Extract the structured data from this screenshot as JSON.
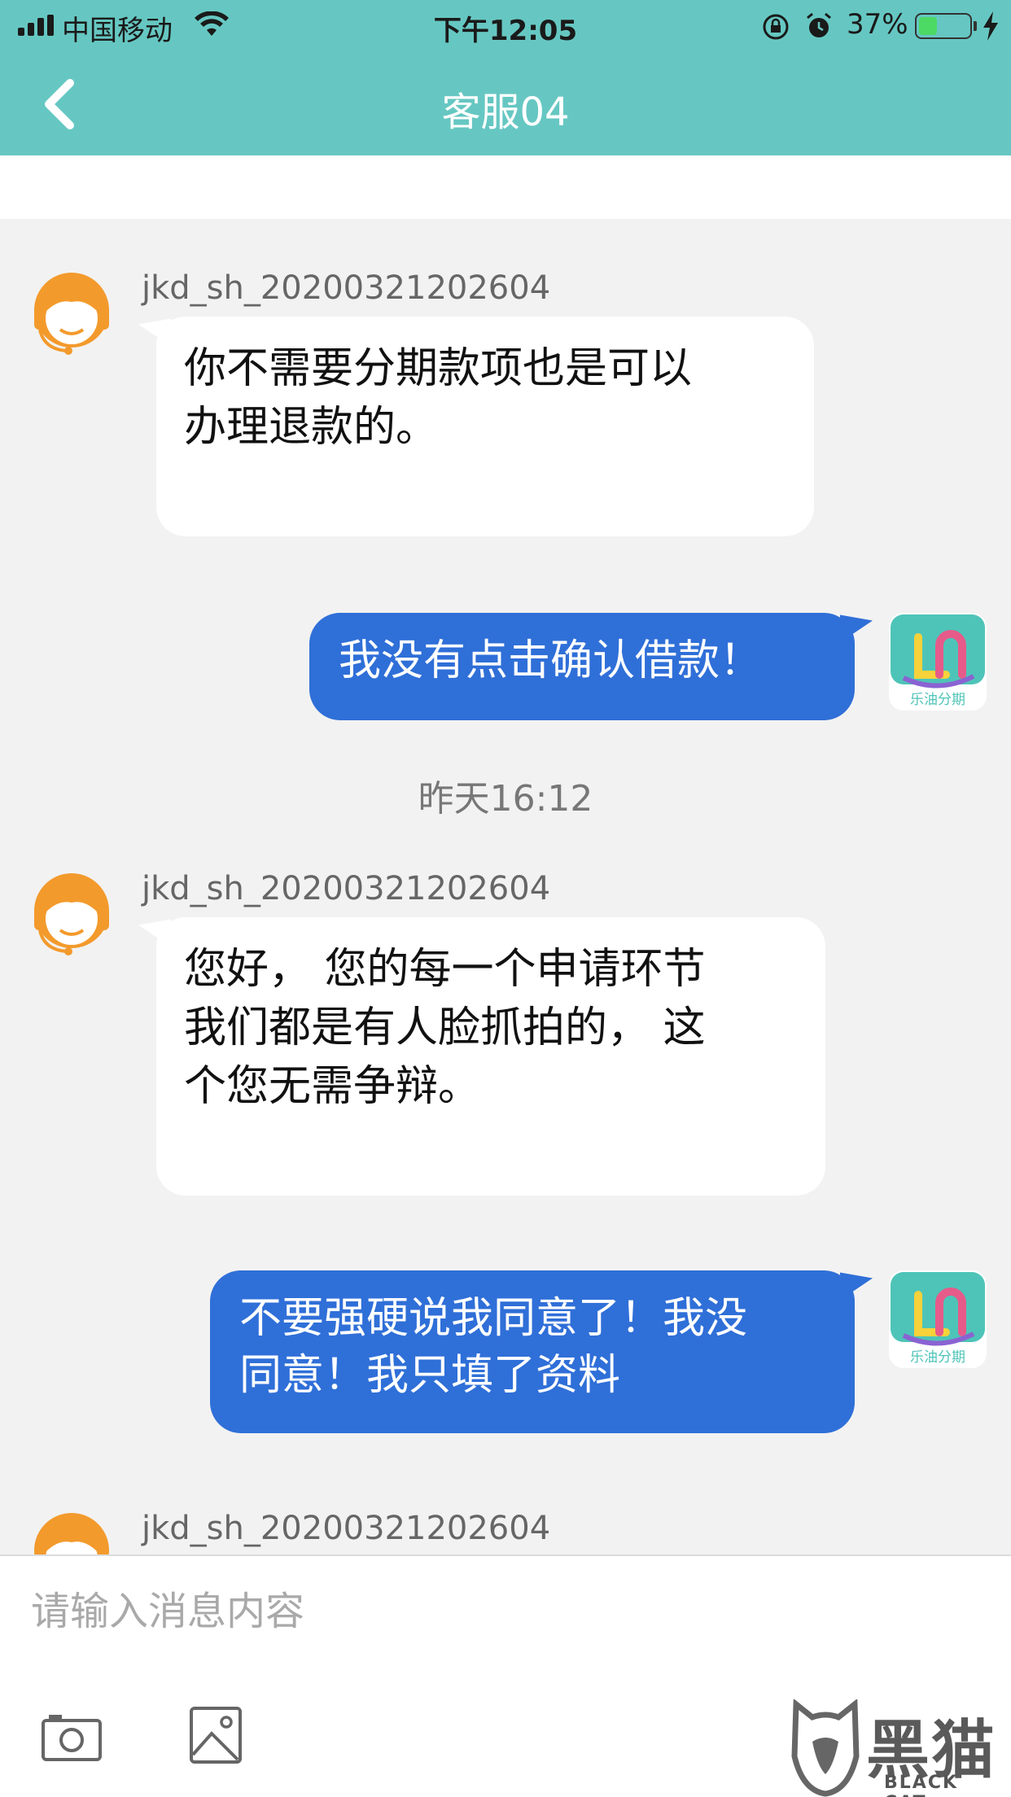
{
  "status_bar": {
    "carrier": "中国移动",
    "time": "下午12:05",
    "battery_percent": "37%",
    "battery_level": 0.37
  },
  "nav": {
    "title": "客服04",
    "back_icon": "chevron-left-icon"
  },
  "colors": {
    "header": "#66c7c2",
    "outgoing_bubble": "#2f6fd8",
    "incoming_bubble": "#ffffff",
    "agent_avatar": "#f39a2c"
  },
  "messages": [
    {
      "direction": "incoming",
      "sender": "jkd_sh_20200321202604",
      "lines": [
        " 你不需要分期款项也是可以",
        "办理退款的。"
      ]
    },
    {
      "direction": "outgoing",
      "lines": [
        "我没有点击确认借款！"
      ]
    },
    {
      "type": "timestamp",
      "text": "昨天16:12"
    },
    {
      "direction": "incoming",
      "sender": "jkd_sh_20200321202604",
      "lines": [
        "您好， 您的每一个申请环节",
        "我们都是有人脸抓拍的， 这",
        "个您无需争辩。"
      ]
    },
    {
      "direction": "outgoing",
      "lines": [
        "不要强硬说我同意了！我没",
        "同意！我只填了资料"
      ]
    },
    {
      "direction": "incoming",
      "sender": "jkd_sh_20200321202604",
      "lines": []
    }
  ],
  "user_avatar": {
    "app_name": "乐油分期"
  },
  "composer": {
    "placeholder": "请输入消息内容",
    "camera_icon": "camera-icon",
    "image_icon": "image-icon"
  },
  "watermark": {
    "text": "黑猫",
    "subtext": "BLACK CAT"
  }
}
